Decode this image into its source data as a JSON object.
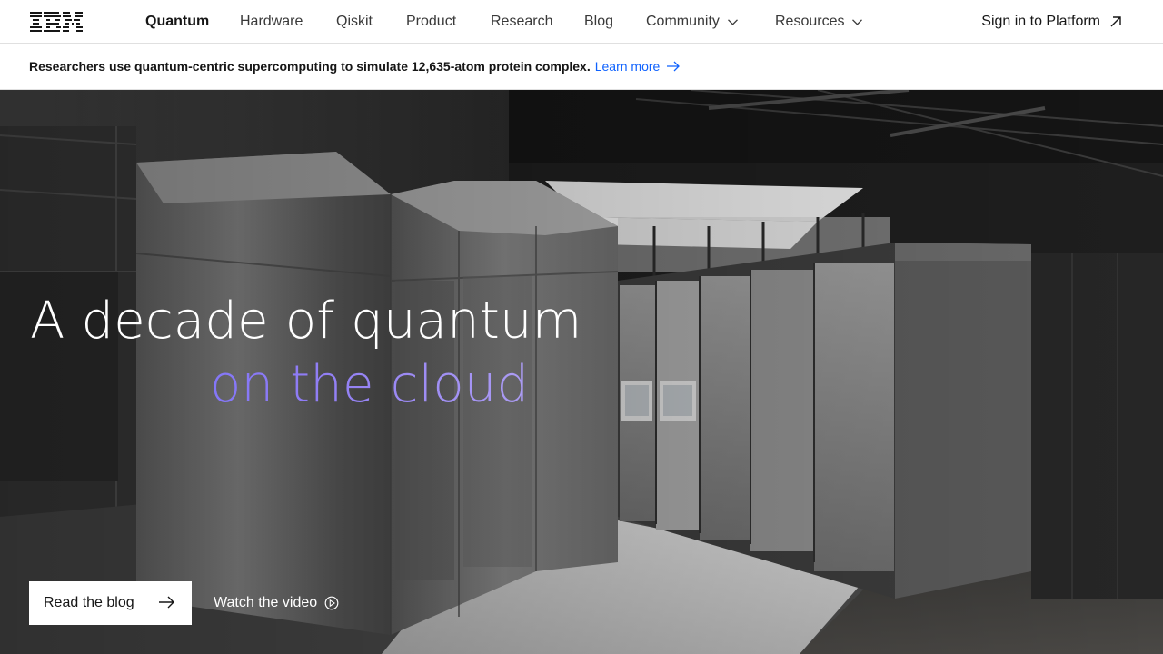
{
  "brand": {
    "logo_text": "IBM"
  },
  "nav": {
    "items": [
      {
        "label": "Quantum",
        "active": true
      },
      {
        "label": "Hardware"
      },
      {
        "label": "Qiskit"
      },
      {
        "label": "Product"
      },
      {
        "label": "Research"
      },
      {
        "label": "Blog"
      },
      {
        "label": "Community",
        "icon": "chevron-down-icon"
      },
      {
        "label": "Resources",
        "icon": "chevron-down-icon"
      }
    ],
    "signin_label": "Sign in to Platform",
    "signin_icon": "arrow-up-right-icon"
  },
  "banner": {
    "text": "Researchers use quantum-centric supercomputing to simulate 12,635-atom protein complex.",
    "link_label": "Learn more",
    "link_icon": "arrow-right-icon",
    "link_color": "#0f62fe"
  },
  "hero": {
    "headline_line1": "A decade of quantum",
    "headline_line2": "on the cloud",
    "accent_gradient": [
      "#6f6dff",
      "#b3a4f3"
    ],
    "primary_button_label": "Read the blog",
    "primary_button_icon": "arrow-right-icon",
    "secondary_button_label": "Watch the video",
    "secondary_button_icon": "play-circle-icon"
  }
}
